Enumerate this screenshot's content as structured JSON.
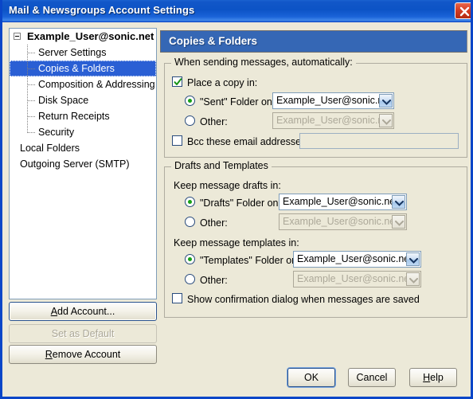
{
  "window": {
    "title": "Mail & Newsgroups Account Settings",
    "close_icon": "close-icon",
    "frame_color": "#0A46C8",
    "dialog_background": "#ECE9D8"
  },
  "sidebar": {
    "items": [
      {
        "label": "Example_User@sonic.net",
        "level": "root",
        "selected": false
      },
      {
        "label": "Server Settings",
        "level": "child",
        "selected": false
      },
      {
        "label": "Copies & Folders",
        "level": "child",
        "selected": true
      },
      {
        "label": "Composition & Addressing",
        "level": "child",
        "selected": false
      },
      {
        "label": "Disk Space",
        "level": "child",
        "selected": false
      },
      {
        "label": "Return Receipts",
        "level": "child",
        "selected": false
      },
      {
        "label": "Security",
        "level": "child",
        "selected": false
      },
      {
        "label": "Local Folders",
        "level": "top",
        "selected": false
      },
      {
        "label": "Outgoing Server (SMTP)",
        "level": "top",
        "selected": false
      }
    ],
    "selection_color": "#2A5FD4",
    "buttons": {
      "add_account": "Add Account...",
      "add_account_accesskey": "A",
      "set_as_default": "Set as Default",
      "set_as_default_accesskey": "f",
      "set_as_default_disabled": true,
      "remove_account": "Remove Account",
      "remove_account_accesskey": "R"
    }
  },
  "panel": {
    "header_title": "Copies & Folders",
    "header_color": "#3567B5"
  },
  "sending_group": {
    "legend": "When sending messages, automatically:",
    "place_copy": {
      "label": "Place a copy in:",
      "checked": true
    },
    "sent_folder": {
      "label": "\"Sent\" Folder on:",
      "selected": true,
      "value": "Example_User@sonic.net",
      "enabled": true
    },
    "sent_other": {
      "label": "Other:",
      "selected": false,
      "value": "Example_User@sonic.net",
      "enabled": false
    },
    "bcc": {
      "label": "Bcc these email addresses:",
      "checked": false,
      "value": "",
      "enabled": false
    }
  },
  "drafts_group": {
    "legend": "Drafts and Templates",
    "drafts_heading": "Keep message drafts in:",
    "drafts_folder": {
      "label": "\"Drafts\" Folder on:",
      "selected": true,
      "value": "Example_User@sonic.net",
      "enabled": true
    },
    "drafts_other": {
      "label": "Other:",
      "selected": false,
      "value": "Example_User@sonic.net",
      "enabled": false
    },
    "templates_heading": "Keep message templates in:",
    "templates_folder": {
      "label": "\"Templates\" Folder on:",
      "selected": true,
      "value": "Example_User@sonic.net",
      "enabled": true
    },
    "templates_other": {
      "label": "Other:",
      "selected": false,
      "value": "Example_User@sonic.net",
      "enabled": false
    },
    "show_confirmation": {
      "label": "Show confirmation dialog when messages are saved",
      "checked": false
    }
  },
  "dialog_buttons": {
    "ok": "OK",
    "cancel": "Cancel",
    "help": "Help",
    "help_accesskey": "H",
    "default_button": "OK"
  }
}
